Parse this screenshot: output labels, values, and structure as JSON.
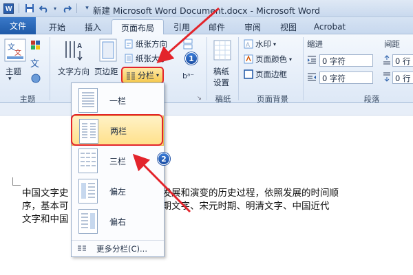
{
  "window": {
    "title": "新建 Microsoft Word Document.docx  -  Microsoft Word"
  },
  "quick_access": {
    "icons": [
      "word-app-icon",
      "save-icon",
      "undo-icon",
      "redo-icon",
      "customize-icon"
    ]
  },
  "tabs": [
    {
      "label": "文件"
    },
    {
      "label": "开始"
    },
    {
      "label": "插入"
    },
    {
      "label": "页面布局"
    },
    {
      "label": "引用"
    },
    {
      "label": "邮件"
    },
    {
      "label": "审阅"
    },
    {
      "label": "视图"
    },
    {
      "label": "Acrobat"
    }
  ],
  "ribbon": {
    "theme_label": "主题",
    "text_direction_label": "文字方向",
    "margins_label": "页边距",
    "paper_direction_label": "纸张方向",
    "paper_size_label": "纸张大小",
    "columns_label": "分栏",
    "manuscript_label_1": "稿纸",
    "manuscript_label_2": "设置",
    "watermark_label": "水印",
    "page_color_label": "页面颜色",
    "page_border_label": "页面边框",
    "indent_label": "缩进",
    "spacing_label": "间距",
    "indent_left_value": "0 字符",
    "indent_right_value": "0 字符",
    "spacing_before_value": "0 行",
    "spacing_after_value": "0 行",
    "group_theme": "主题",
    "group_manuscript": "稿纸",
    "group_page_bg": "页面背景",
    "group_paragraph": "段落"
  },
  "columns_menu": {
    "items": [
      {
        "label": "一栏"
      },
      {
        "label": "两栏"
      },
      {
        "label": "三栏"
      },
      {
        "label": "偏左"
      },
      {
        "label": "偏右"
      }
    ],
    "more_label": "更多分栏(C)...",
    "highlighted": "两栏"
  },
  "document": {
    "line1_a": "中国文字史",
    "line1_b": "数千年的发展和演变的历史过程，依照发展的时间顺",
    "line2_a": "序，基本可",
    "line2_b": "汉、唐时期文字、宋元时期、明清文字、中国近代",
    "line3_a": "文字和中国"
  },
  "annotations": {
    "badge1": "1",
    "badge2": "2",
    "color": "#e3242b"
  },
  "colors": {
    "accent": "#2a5faa",
    "highlight": "#ffe08a",
    "annotation": "#e3242b"
  }
}
